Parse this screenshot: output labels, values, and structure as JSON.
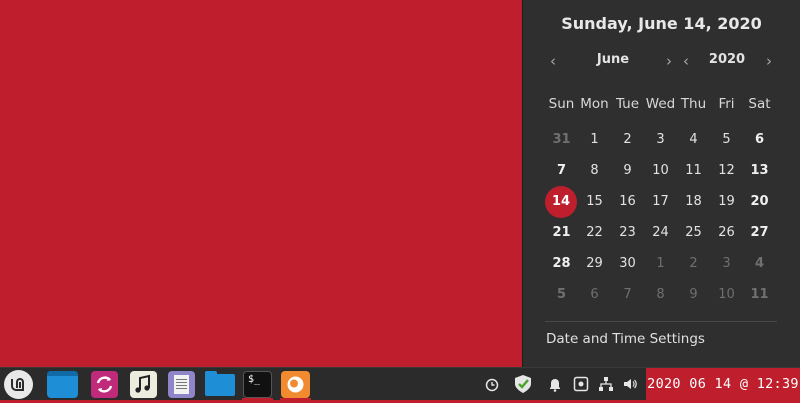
{
  "calendar": {
    "date_title": "Sunday, June 14, 2020",
    "month_label": "June",
    "year_label": "2020",
    "prev_month": "‹",
    "next_month": "›",
    "prev_year": "‹",
    "next_year": "›",
    "weekdays": [
      "Sun",
      "Mon",
      "Tue",
      "Wed",
      "Thu",
      "Fri",
      "Sat"
    ],
    "weeks": [
      [
        "31",
        "1",
        "2",
        "3",
        "4",
        "5",
        "6"
      ],
      [
        "7",
        "8",
        "9",
        "10",
        "11",
        "12",
        "13"
      ],
      [
        "14",
        "15",
        "16",
        "17",
        "18",
        "19",
        "20"
      ],
      [
        "21",
        "22",
        "23",
        "24",
        "25",
        "26",
        "27"
      ],
      [
        "28",
        "29",
        "30",
        "1",
        "2",
        "3",
        "4"
      ],
      [
        "5",
        "6",
        "7",
        "8",
        "9",
        "10",
        "11"
      ]
    ],
    "today": "14",
    "settings_link": "Date and Time Settings"
  },
  "taskbar": {
    "launchers": [
      {
        "name": "mint-menu-icon"
      },
      {
        "name": "show-desktop-icon"
      },
      {
        "name": "update-manager-icon"
      },
      {
        "name": "music-player-icon"
      },
      {
        "name": "text-editor-icon"
      },
      {
        "name": "file-manager-icon"
      },
      {
        "name": "terminal-icon"
      },
      {
        "name": "firefox-icon"
      }
    ],
    "tray": [
      {
        "name": "alarm-clock-icon"
      },
      {
        "name": "update-shield-icon"
      },
      {
        "name": "notifications-bell-icon"
      },
      {
        "name": "keyboard-layout-icon"
      },
      {
        "name": "network-icon"
      },
      {
        "name": "volume-icon"
      }
    ],
    "clock_text": "2020 06 14 @ 12:39"
  },
  "colors": {
    "desktop_bg": "#bf1e2d",
    "popup_bg": "#2f2f2f",
    "taskbar_bg": "#2b2b2b",
    "accent": "#bf1e2d",
    "folder_blue": "#1e8fd6",
    "firefox_orange": "#f28a30"
  }
}
